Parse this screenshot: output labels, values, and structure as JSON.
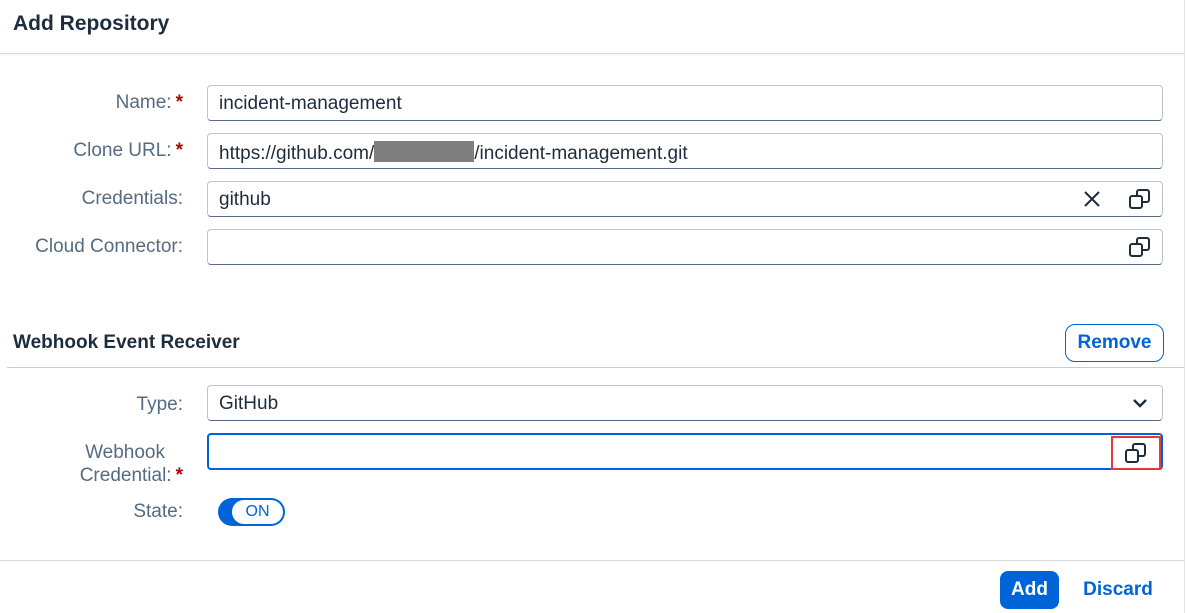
{
  "dialog": {
    "title": "Add Repository"
  },
  "form": {
    "name": {
      "label": "Name:",
      "required_mark": "*",
      "value": "incident-management"
    },
    "clone_url": {
      "label": "Clone URL:",
      "required_mark": "*",
      "value_prefix": "https://github.com/",
      "value_suffix": "/incident-management.git"
    },
    "credentials": {
      "label": "Credentials:",
      "value": "github",
      "clear_icon": "close-icon",
      "value_help_icon": "value-help-icon"
    },
    "cloud_connector": {
      "label": "Cloud Connector:",
      "value": "",
      "value_help_icon": "value-help-icon"
    }
  },
  "webhook": {
    "section_title": "Webhook Event Receiver",
    "remove_label": "Remove",
    "type": {
      "label": "Type:",
      "value": "GitHub",
      "dropdown_icon": "chevron-down-icon"
    },
    "credential": {
      "label_line1": "Webhook",
      "label_line2": "Credential:",
      "required_mark": "*",
      "value": "",
      "value_help_icon": "value-help-icon"
    },
    "state": {
      "label": "State:",
      "switch_text": "ON"
    }
  },
  "footer": {
    "add_label": "Add",
    "discard_label": "Discard"
  },
  "colors": {
    "accent": "#0064d9",
    "required": "#aa0808",
    "label": "#556b82",
    "highlight": "#e53935"
  }
}
